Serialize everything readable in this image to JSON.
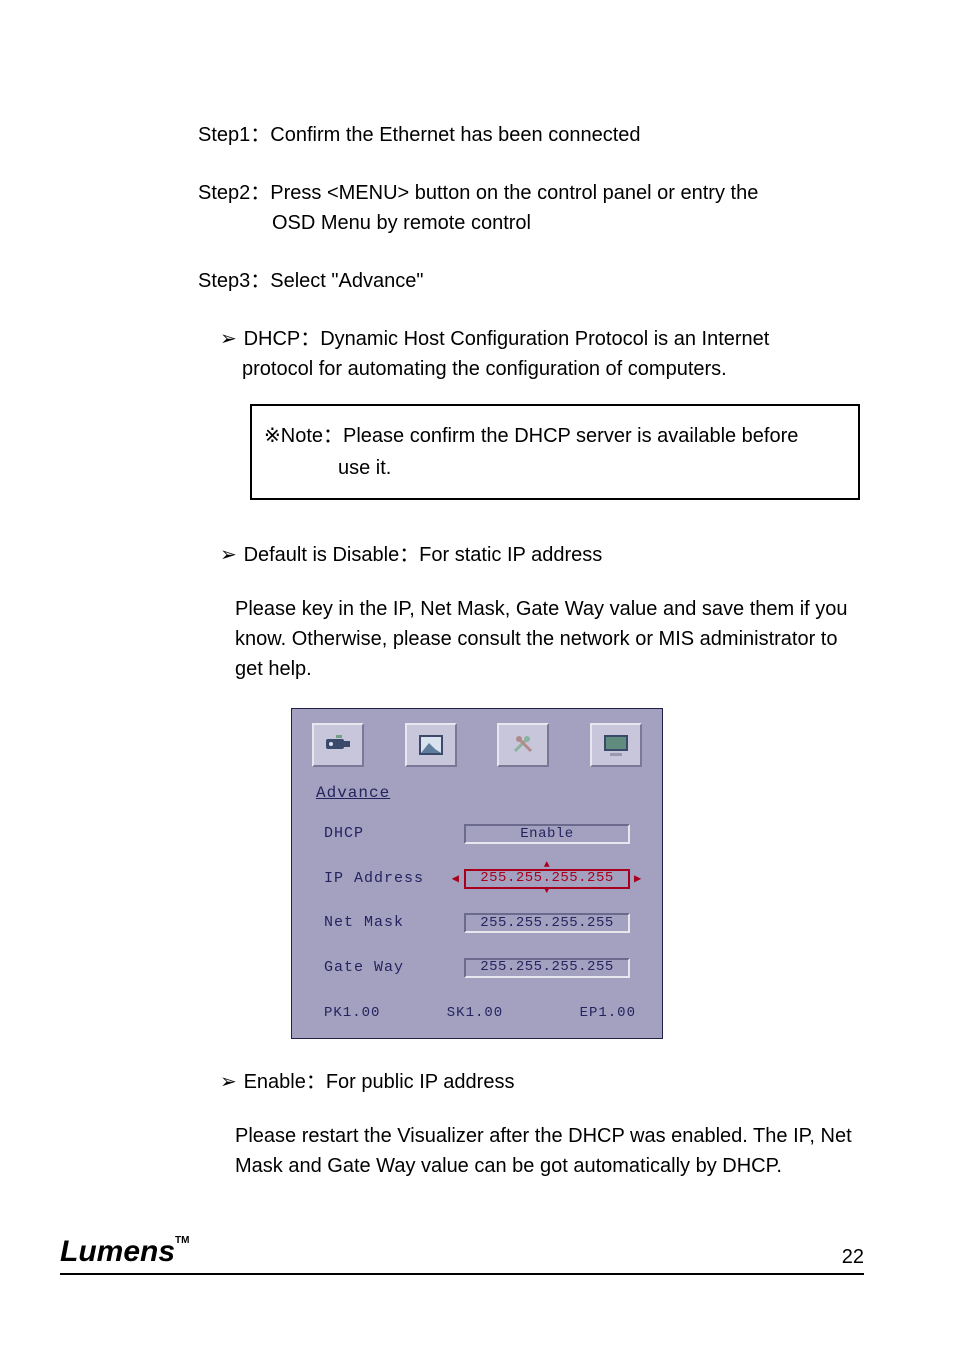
{
  "steps": {
    "step1": "Step1：Confirm the Ethernet has been connected",
    "step2_line1": "Step2：Press <MENU> button on the control panel or entry the",
    "step2_line2": "OSD Menu by remote control",
    "step3": "Step3：Select  \"Advance\""
  },
  "bullets": {
    "dhcp_line1": "DHCP：Dynamic Host Configuration Protocol is an Internet",
    "dhcp_line2": "protocol for automating the configuration of computers.",
    "note_line1": "※Note：Please confirm the DHCP server is available before",
    "note_line2": "use it.",
    "default_label": "Default is Disable：For static IP address",
    "static_desc": "Please key in the IP, Net Mask, Gate Way value and save them if you know. Otherwise, please consult the network or MIS administrator to get help.",
    "enable_label": "Enable：For public IP address",
    "enable_desc": "Please restart the Visualizer after the DHCP was enabled. The IP, Net Mask and Gate Way value can be got automatically by DHCP."
  },
  "osd": {
    "title": "Advance",
    "rows": {
      "dhcp": {
        "label": "DHCP",
        "value": "Enable"
      },
      "ip": {
        "label": "IP Address",
        "value": "255.255.255.255"
      },
      "mask": {
        "label": "Net Mask",
        "value": "255.255.255.255"
      },
      "gw": {
        "label": "Gate Way",
        "value": "255.255.255.255"
      }
    },
    "versions": {
      "pk": "PK1.00",
      "sk": "SK1.00",
      "ep": "EP1.00"
    }
  },
  "footer": {
    "logo": "Lumens",
    "tm": "TM",
    "page": "22"
  }
}
